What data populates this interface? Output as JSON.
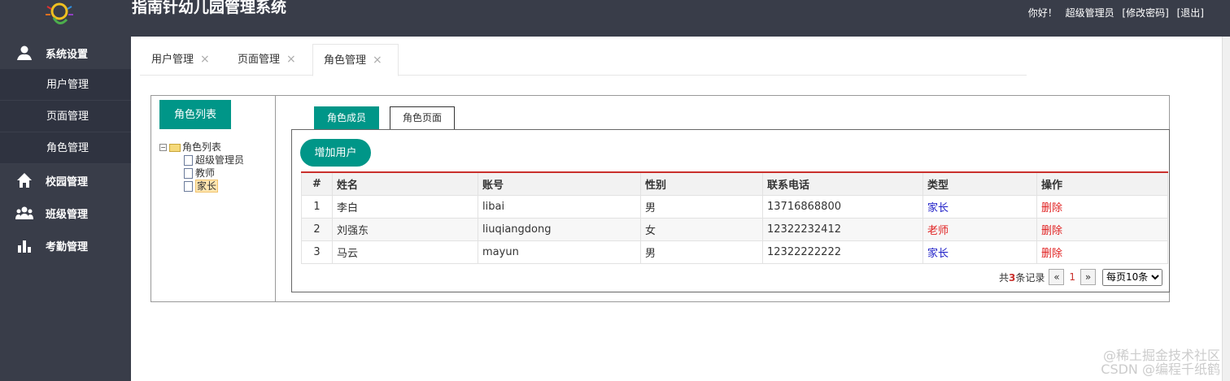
{
  "header": {
    "title": "指南针幼儿园管理系统",
    "greeting": "你好！",
    "user_role": "超级管理员",
    "change_password": "[修改密码]",
    "logout": "[退出]"
  },
  "sidebar": {
    "groups": [
      {
        "label": "系统设置",
        "icon": "user-icon"
      },
      {
        "label": "校园管理",
        "icon": "home-icon"
      },
      {
        "label": "班级管理",
        "icon": "group-icon"
      },
      {
        "label": "考勤管理",
        "icon": "bar-chart-icon"
      }
    ],
    "subitems": [
      "用户管理",
      "页面管理",
      "角色管理"
    ]
  },
  "tabs": [
    {
      "label": "用户管理",
      "close": "×"
    },
    {
      "label": "页面管理",
      "close": "×"
    },
    {
      "label": "角色管理",
      "close": "×",
      "active": true
    }
  ],
  "left_panel": {
    "button": "角色列表",
    "tree_root": "角色列表",
    "tree_items": [
      "超级管理员",
      "教师",
      "家长"
    ],
    "selected": "家长"
  },
  "subtabs": [
    "角色成员",
    "角色页面"
  ],
  "add_user": "增加用户",
  "table": {
    "headers": [
      "#",
      "姓名",
      "账号",
      "性别",
      "联系电话",
      "类型",
      "操作"
    ],
    "rows": [
      {
        "n": "1",
        "name": "李白",
        "account": "libai",
        "gender": "男",
        "phone": "13716868800",
        "type": "家长",
        "op": "删除"
      },
      {
        "n": "2",
        "name": "刘强东",
        "account": "liuqiangdong",
        "gender": "女",
        "phone": "12322232412",
        "type": "老师",
        "op": "删除"
      },
      {
        "n": "3",
        "name": "马云",
        "account": "mayun",
        "gender": "男",
        "phone": "12322222222",
        "type": "家长",
        "op": "删除"
      }
    ]
  },
  "pager": {
    "prefix": "共",
    "count": "3",
    "suffix": "条记录",
    "prev": "«",
    "page": "1",
    "next": "»",
    "page_size": "每页10条"
  },
  "watermark": [
    "@稀土掘金技术社区",
    "CSDN @编程千纸鹤"
  ],
  "colors": {
    "accent": "#009688",
    "header_bg": "#393d49",
    "danger": "#e02020",
    "link_blue": "#1e1ec8"
  }
}
